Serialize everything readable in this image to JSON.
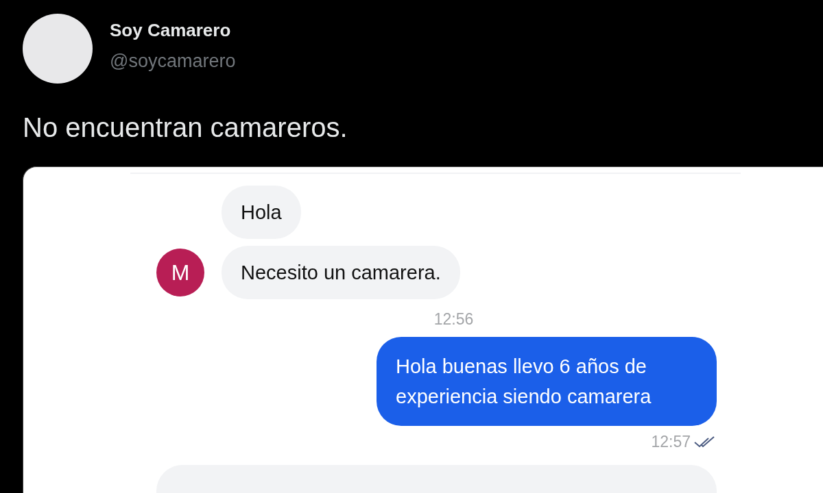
{
  "author": {
    "name": "Soy Camarero",
    "handle": "@soycamarero"
  },
  "tweet": {
    "text": "No encuentran camareros."
  },
  "chat": {
    "items": [
      {
        "kind": "received",
        "text": "Hola"
      },
      {
        "kind": "received",
        "text": "Necesito un camarera.",
        "avatar": "M"
      },
      {
        "kind": "time-received",
        "text": "12:56"
      },
      {
        "kind": "sent",
        "text": "Hola buenas llevo 6 años de experiencia siendo camarera"
      },
      {
        "kind": "time-sent",
        "text": "12:57",
        "read": true
      },
      {
        "kind": "cut-bubble"
      }
    ]
  }
}
